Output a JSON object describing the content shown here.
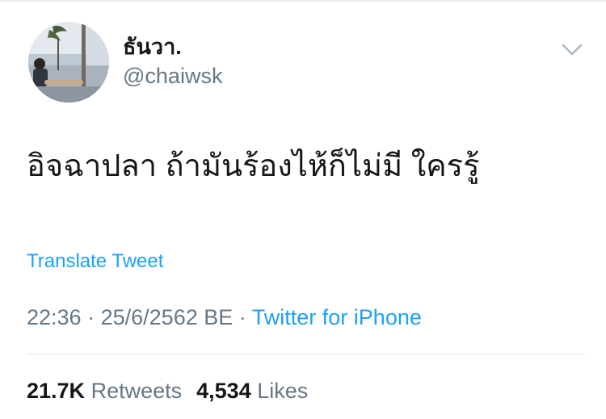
{
  "user": {
    "display_name": "ธันวา.",
    "handle": "@chaiwsk"
  },
  "tweet": {
    "text": "อิจฉาปลา ถ้ามันร้องไห้ก็ไม่มี ใครรู้",
    "translate_label": "Translate Tweet"
  },
  "meta": {
    "time": "22:36",
    "separator": "·",
    "date": "25/6/2562 BE",
    "source": "Twitter for iPhone"
  },
  "stats": {
    "retweets_count": "21.7K",
    "retweets_label": "Retweets",
    "likes_count": "4,534",
    "likes_label": "Likes"
  },
  "icons": {
    "menu": "chevron-down-icon"
  },
  "colors": {
    "link": "#1da1f2",
    "secondary_text": "#657786",
    "primary_text": "#14171a",
    "divider": "#e1e8ed"
  }
}
